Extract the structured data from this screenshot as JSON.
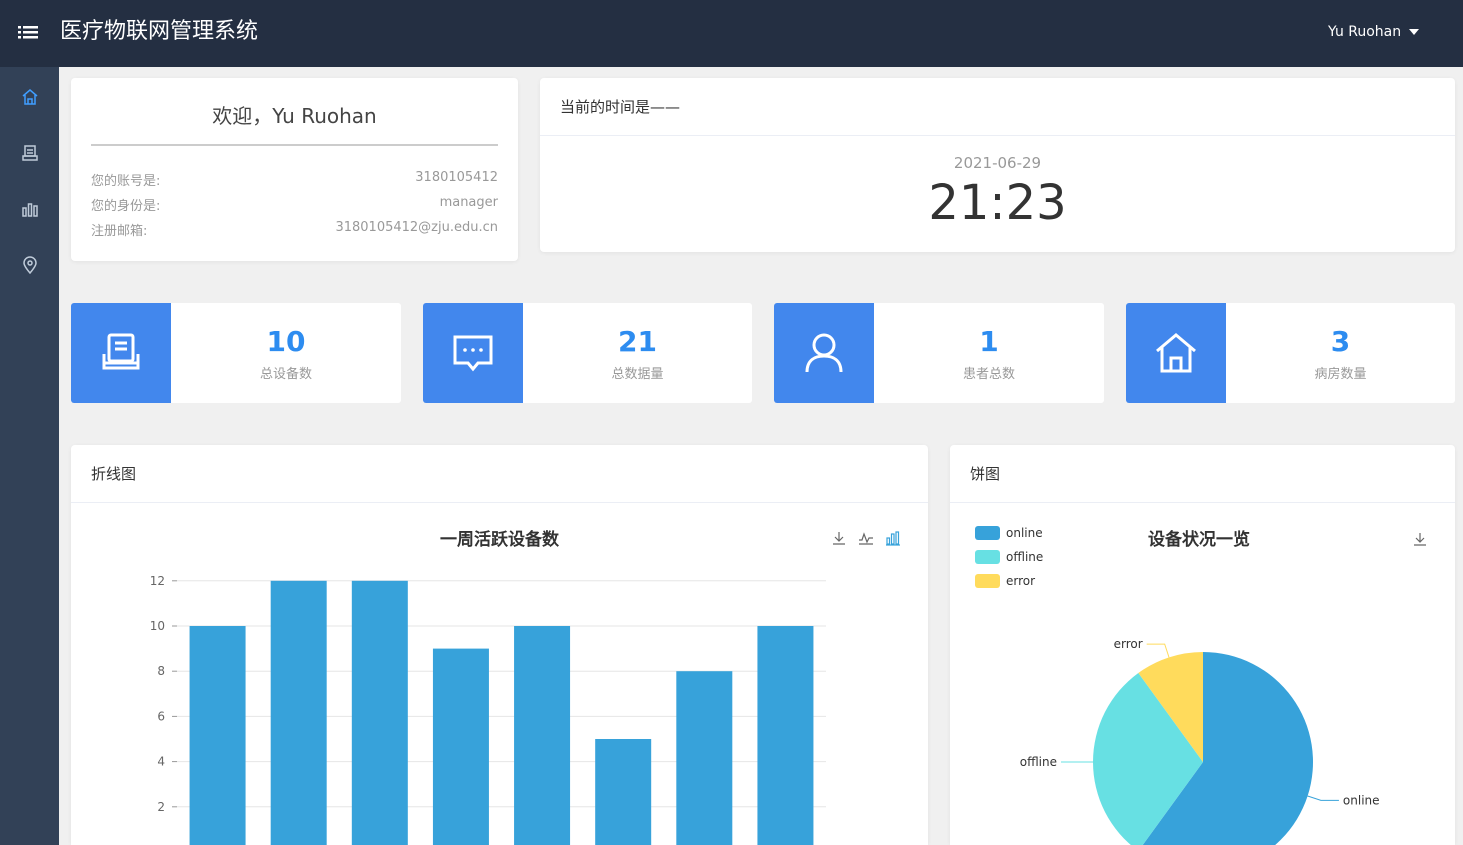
{
  "header": {
    "title": "医疗物联网管理系统",
    "username": "Yu Ruohan"
  },
  "sidebar": {
    "items": [
      {
        "name": "home-icon",
        "active": true
      },
      {
        "name": "device-icon",
        "active": false
      },
      {
        "name": "chart-icon",
        "active": false
      },
      {
        "name": "location-icon",
        "active": false
      }
    ]
  },
  "welcome": {
    "title": "欢迎，Yu Ruohan",
    "rows": [
      {
        "label": "您的账号是:",
        "value": "3180105412"
      },
      {
        "label": "您的身份是:",
        "value": "manager"
      },
      {
        "label": "注册邮箱:",
        "value": "3180105412@zju.edu.cn"
      }
    ]
  },
  "clock": {
    "header": "当前的时间是——",
    "date": "2021-06-29",
    "time": "21:23"
  },
  "stats": [
    {
      "value": "10",
      "label": "总设备数",
      "icon": "device-icon"
    },
    {
      "value": "21",
      "label": "总数据量",
      "icon": "message-icon"
    },
    {
      "value": "1",
      "label": "患者总数",
      "icon": "user-icon"
    },
    {
      "value": "3",
      "label": "病房数量",
      "icon": "home-icon"
    }
  ],
  "colors": {
    "accent": "#4287ed",
    "bar": "#37a2da",
    "online": "#37a2da",
    "offline": "#67e0e3",
    "error": "#ffdb5c"
  },
  "line_card": {
    "header": "折线图"
  },
  "pie_card": {
    "header": "饼图"
  },
  "chart_data": [
    {
      "type": "bar",
      "title": "一周活跃设备数",
      "categories": [
        "",
        "",
        "",
        "",
        "",
        "",
        "",
        ""
      ],
      "values": [
        10,
        12,
        12,
        9,
        10,
        5,
        8,
        10
      ],
      "yticks": [
        2,
        4,
        6,
        8,
        10,
        12
      ],
      "ylim": [
        0,
        12
      ],
      "grid": true,
      "toolbox": [
        "download-icon",
        "line-chart-icon",
        "bar-chart-icon"
      ]
    },
    {
      "type": "pie",
      "title": "设备状况一览",
      "labels": [
        "online",
        "offline",
        "error"
      ],
      "values": [
        6,
        3,
        1
      ],
      "legend": "top-left",
      "toolbox": [
        "download-icon"
      ]
    }
  ]
}
